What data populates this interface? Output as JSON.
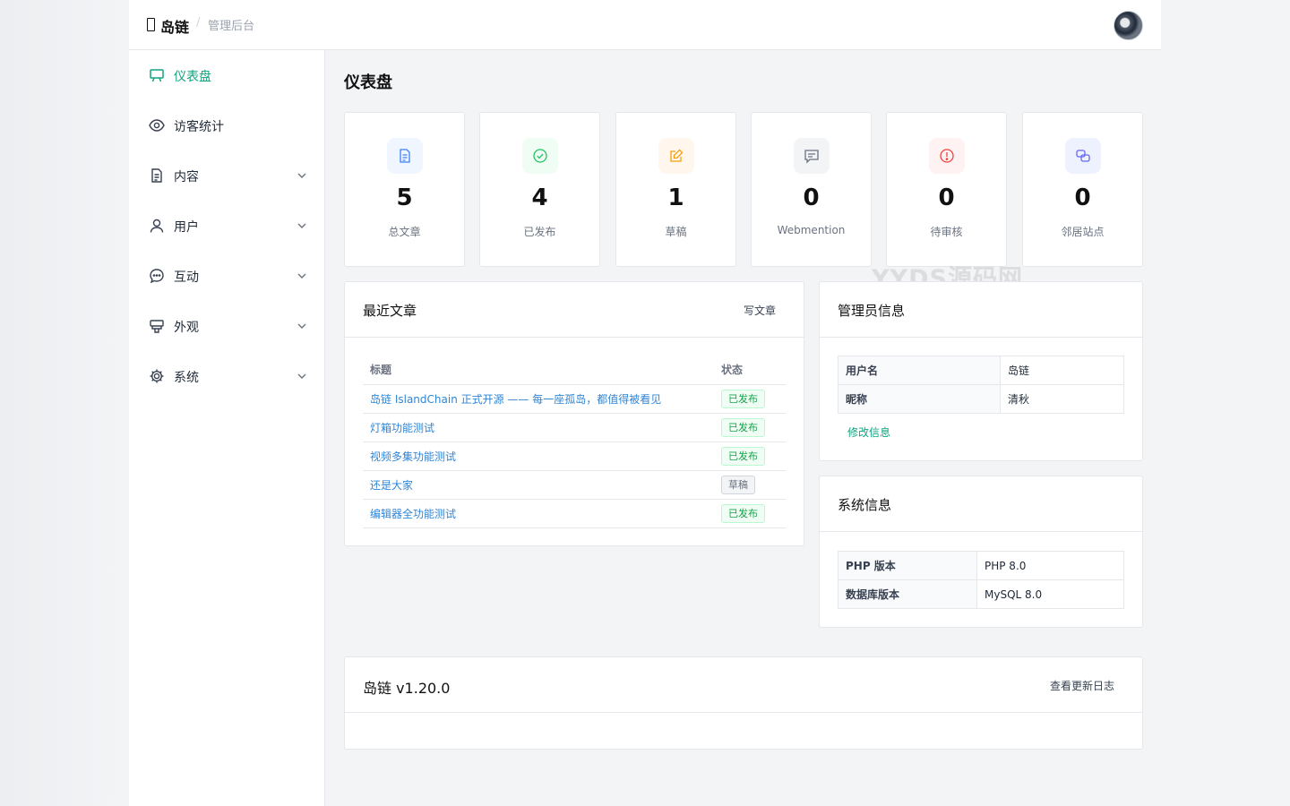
{
  "header": {
    "brand": "岛链",
    "separator": "/",
    "subtitle": "管理后台"
  },
  "sidebar": {
    "items": [
      {
        "label": "仪表盘",
        "icon": "dashboard-icon",
        "active": true
      },
      {
        "label": "访客统计",
        "icon": "eye-icon"
      },
      {
        "label": "内容",
        "icon": "document-icon",
        "expandable": true
      },
      {
        "label": "用户",
        "icon": "user-icon",
        "expandable": true
      },
      {
        "label": "互动",
        "icon": "chat-icon",
        "expandable": true
      },
      {
        "label": "外观",
        "icon": "brush-icon",
        "expandable": true
      },
      {
        "label": "系统",
        "icon": "gear-icon",
        "expandable": true
      }
    ]
  },
  "page": {
    "title": "仪表盘"
  },
  "stats": [
    {
      "value": "5",
      "label": "总文章",
      "icon": "file-text-icon",
      "color": "#3b82f6",
      "bg": "#eff6ff"
    },
    {
      "value": "4",
      "label": "已发布",
      "icon": "check-circle-icon",
      "color": "#22c55e",
      "bg": "#f0fdf4"
    },
    {
      "value": "1",
      "label": "草稿",
      "icon": "edit-icon",
      "color": "#f59e0b",
      "bg": "#fff7ed"
    },
    {
      "value": "0",
      "label": "Webmention",
      "icon": "message-icon",
      "color": "#6b7280",
      "bg": "#f3f4f6"
    },
    {
      "value": "0",
      "label": "待审核",
      "icon": "alert-circle-icon",
      "color": "#ef4444",
      "bg": "#fef2f2"
    },
    {
      "value": "0",
      "label": "邻居站点",
      "icon": "link-icon",
      "color": "#6366f1",
      "bg": "#eef2ff"
    }
  ],
  "recent_posts": {
    "title": "最近文章",
    "action": "写文章",
    "columns": [
      "标题",
      "状态"
    ],
    "rows": [
      {
        "title": "岛链 IslandChain 正式开源 —— 每一座孤岛，都值得被看见",
        "status": "已发布",
        "kind": "pub"
      },
      {
        "title": "灯箱功能测试",
        "status": "已发布",
        "kind": "pub"
      },
      {
        "title": "视频多集功能测试",
        "status": "已发布",
        "kind": "pub"
      },
      {
        "title": "还是大家",
        "status": "草稿",
        "kind": "draft"
      },
      {
        "title": "编辑器全功能测试",
        "status": "已发布",
        "kind": "pub"
      }
    ]
  },
  "admin_info": {
    "title": "管理员信息",
    "rows": [
      {
        "key": "用户名",
        "value": "岛链"
      },
      {
        "key": "昵称",
        "value": "清秋"
      }
    ],
    "edit_label": "修改信息"
  },
  "system_info": {
    "title": "系统信息",
    "rows": [
      {
        "key": "PHP 版本",
        "value": "PHP 8.0"
      },
      {
        "key": "数据库版本",
        "value": "MySQL 8.0"
      }
    ]
  },
  "version": {
    "title": "岛链 v1.20.0",
    "action": "查看更新日志"
  },
  "watermark": "YYDS源码网",
  "colors": {
    "accent": "#10a37f",
    "link": "#2f86d6",
    "background": "#f3f4f6"
  }
}
